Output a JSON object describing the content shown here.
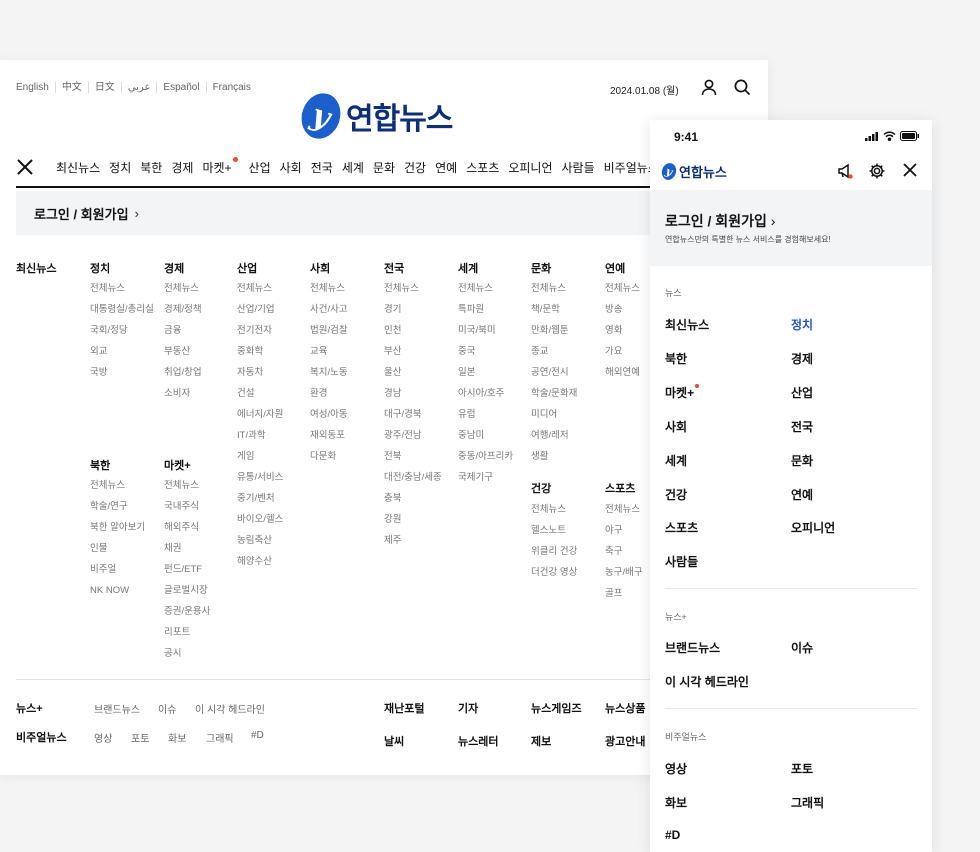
{
  "desktop": {
    "languages": [
      "English",
      "中文",
      "日文",
      "عربي",
      "Español",
      "Français"
    ],
    "date": "2024.01.08 (월)",
    "logo_text": "연합뉴스",
    "nav": [
      "최신뉴스",
      "정치",
      "북한",
      "경제",
      "마켓+",
      "산업",
      "사회",
      "전국",
      "세계",
      "문화",
      "건강",
      "연예",
      "스포츠",
      "오피니언",
      "사람들",
      "비주얼뉴스"
    ],
    "login_label": "로그인 / 회원가입",
    "columns": {
      "latest": {
        "title": "최신뉴스"
      },
      "politics": {
        "title": "정치",
        "items": [
          "전체뉴스",
          "대통령실/총리실",
          "국회/정당",
          "외교",
          "국방"
        ]
      },
      "economy": {
        "title": "경제",
        "items": [
          "전체뉴스",
          "경제/정책",
          "금융",
          "부동산",
          "취업/창업",
          "소비자"
        ]
      },
      "industry": {
        "title": "산업",
        "items": [
          "전체뉴스",
          "산업/기업",
          "전기전자",
          "중화학",
          "자동차",
          "건설",
          "에너지/자원",
          "IT/과학",
          "게임",
          "유통/서비스",
          "중기/벤처",
          "바이오/헬스",
          "농림축산",
          "해양수산"
        ]
      },
      "society": {
        "title": "사회",
        "items": [
          "전체뉴스",
          "사건/사고",
          "법원/검찰",
          "교육",
          "복지/노동",
          "환경",
          "여성/아동",
          "재외동포",
          "다문화"
        ]
      },
      "national": {
        "title": "전국",
        "items": [
          "전체뉴스",
          "경기",
          "인천",
          "부산",
          "울산",
          "경남",
          "대구/경북",
          "광주/전남",
          "전북",
          "대전/충남/세종",
          "충북",
          "강원",
          "제주"
        ]
      },
      "world": {
        "title": "세계",
        "items": [
          "전체뉴스",
          "특파원",
          "미국/북미",
          "중국",
          "일본",
          "아시아/호주",
          "유럽",
          "중남미",
          "중동/아프리카",
          "국제기구"
        ]
      },
      "culture": {
        "title": "문화",
        "items": [
          "전체뉴스",
          "책/문학",
          "만화/웹툰",
          "종교",
          "공연/전시",
          "학술/문화재",
          "미디어",
          "여행/레저",
          "생활"
        ]
      },
      "entertainment": {
        "title": "연예",
        "items": [
          "전체뉴스",
          "방송",
          "영화",
          "가요",
          "해외연예"
        ]
      },
      "northkorea": {
        "title": "북한",
        "items": [
          "전체뉴스",
          "학술/연구",
          "북한 알아보기",
          "인물",
          "비주얼",
          "NK NOW"
        ]
      },
      "market": {
        "title": "마켓+",
        "items": [
          "전체뉴스",
          "국내주식",
          "해외주식",
          "채권",
          "펀드/ETF",
          "글로벌시장",
          "증권/운용사",
          "리포트",
          "공시"
        ]
      },
      "health": {
        "title": "건강",
        "items": [
          "전체뉴스",
          "헬스노트",
          "위클리 건강",
          "더건강 영상"
        ]
      },
      "sports": {
        "title": "스포츠",
        "items": [
          "전체뉴스",
          "야구",
          "축구",
          "농구/배구",
          "골프"
        ]
      }
    },
    "footer": {
      "newsplus": {
        "title": "뉴스+",
        "items": [
          "브랜드뉴스",
          "이슈",
          "이 시각 헤드라인"
        ]
      },
      "visual": {
        "title": "비주얼뉴스",
        "items": [
          "영상",
          "포토",
          "화보",
          "그래픽",
          "#D"
        ]
      },
      "links_row1": [
        "재난포털",
        "기자",
        "뉴스게임즈",
        "뉴스상품"
      ],
      "links_row2": [
        "날씨",
        "뉴스레터",
        "제보",
        "광고안내"
      ]
    }
  },
  "mobile": {
    "time": "9:41",
    "logo_text": "연합뉴스",
    "login_label": "로그인 / 회원가입",
    "login_sub": "연합뉴스만의 특별한 뉴스 서비스를 경험해보세요!",
    "sections": [
      {
        "title": "뉴스",
        "items": [
          "최신뉴스",
          "정치",
          "북한",
          "경제",
          "마켓+",
          "산업",
          "사회",
          "전국",
          "세계",
          "문화",
          "건강",
          "연예",
          "스포츠",
          "오피니언",
          "사람들"
        ]
      },
      {
        "title": "뉴스+",
        "items": [
          "브랜드뉴스",
          "이슈",
          "이 시각 헤드라인"
        ]
      },
      {
        "title": "비주얼뉴스",
        "items": [
          "영상",
          "포토",
          "화보",
          "그래픽",
          "#D"
        ]
      }
    ],
    "accent_color": "#2456c8",
    "badge_color": "#e8502a"
  }
}
